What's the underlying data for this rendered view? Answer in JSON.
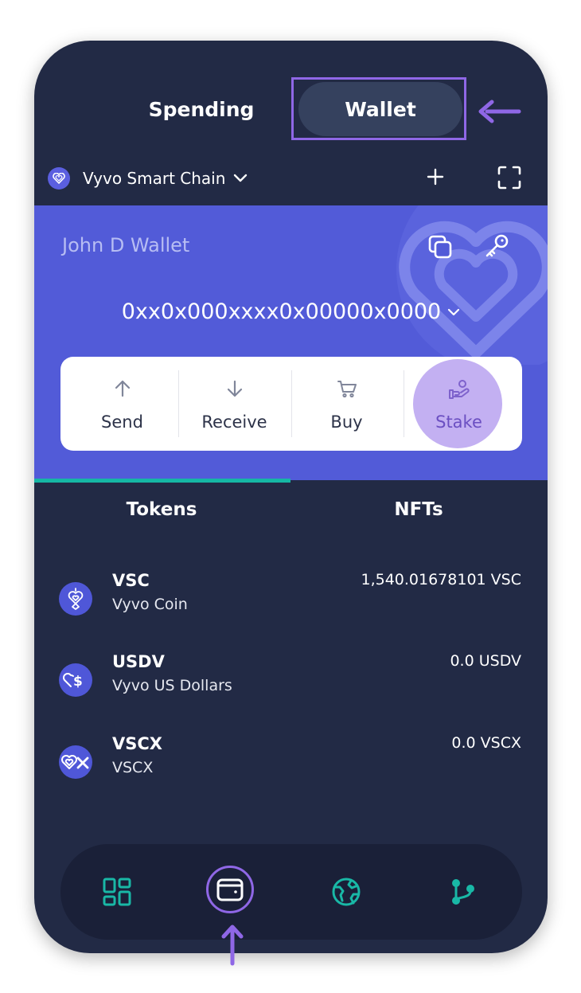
{
  "toggle": {
    "spending": "Spending",
    "wallet": "Wallet"
  },
  "chain": {
    "name": "Vyvo Smart Chain",
    "icon": "vyvo-heart-icon"
  },
  "header_icons": {
    "add": "plus-icon",
    "scan": "scan-icon"
  },
  "wallet": {
    "name": "John D Wallet",
    "address": "0xx0x000xxxx0x00000x0000",
    "icons": {
      "copy": "copy-icon",
      "key": "key-icon"
    }
  },
  "actions": [
    {
      "label": "Send",
      "icon": "arrow-up-icon"
    },
    {
      "label": "Receive",
      "icon": "arrow-down-icon"
    },
    {
      "label": "Buy",
      "icon": "cart-icon"
    },
    {
      "label": "Stake",
      "icon": "hand-coin-icon"
    }
  ],
  "tabs": {
    "tokens": "Tokens",
    "nfts": "NFTs",
    "active": "tokens"
  },
  "tokens": [
    {
      "symbol": "VSC",
      "name": "Vyvo Coin",
      "balance": "1,540.01678101 VSC",
      "icon": "vsc-icon"
    },
    {
      "symbol": "USDV",
      "name": "Vyvo US Dollars",
      "balance": "0.0 USDV",
      "icon": "usdv-icon"
    },
    {
      "symbol": "VSCX",
      "name": "VSCX",
      "balance": "0.0 VSCX",
      "icon": "vscx-icon"
    }
  ],
  "nav": {
    "items": [
      "dashboard-icon",
      "wallet-icon",
      "globe-icon",
      "branch-icon"
    ],
    "active": "wallet-icon"
  },
  "colors": {
    "background": "#222a45",
    "card": "#525bd8",
    "accent": "#16b7a5",
    "highlight": "#8f67e6"
  }
}
